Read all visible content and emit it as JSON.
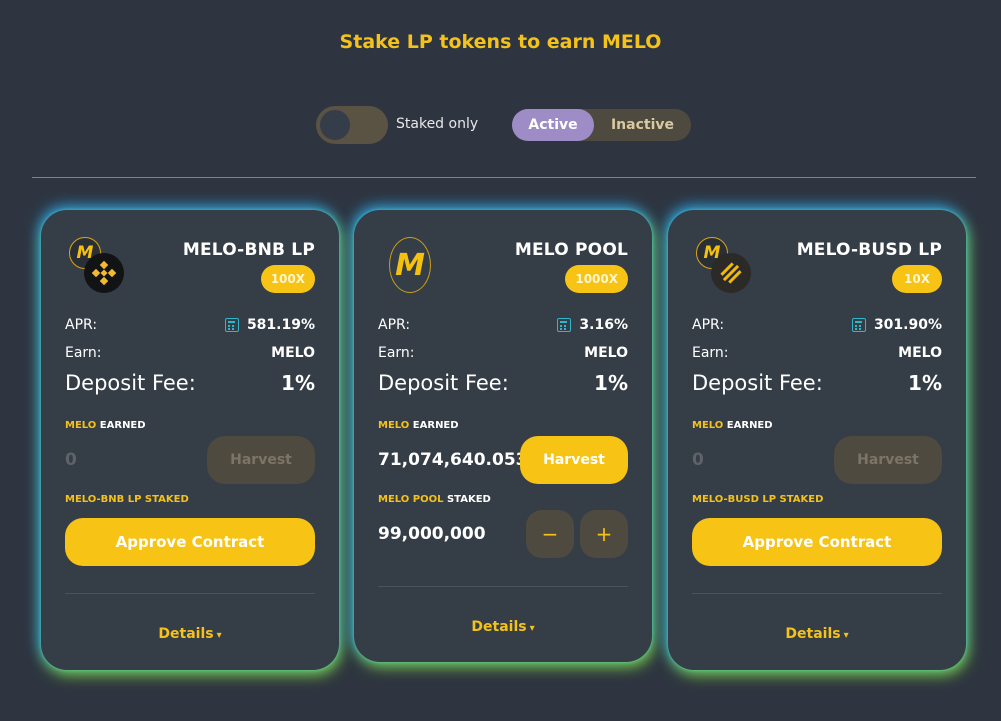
{
  "page": {
    "title": "Stake LP tokens to earn MELO"
  },
  "filters": {
    "staked_only_label": "Staked only",
    "staked_only_on": false,
    "tabs": [
      "Active",
      "Inactive"
    ],
    "active_tab": "Active"
  },
  "colors": {
    "accent": "#f7c415",
    "background": "#2e3540",
    "card": "#353d47",
    "active_tab": "#9d8cc6",
    "calculator_icon": "#2fb6c8"
  },
  "farms": [
    {
      "name": "MELO-BNB LP",
      "multiplier": "100X",
      "apr_label": "APR:",
      "apr": "581.19%",
      "earn_label": "Earn:",
      "earn": "MELO",
      "deposit_fee_label": "Deposit Fee:",
      "deposit_fee": "1%",
      "earned_token": "MELO",
      "earned_word": "EARNED",
      "earned": "0",
      "harvest_label": "Harvest",
      "staked_label": "MELO-BNB LP STAKED",
      "action_label": "Approve Contract",
      "details_label": "Details",
      "icons": [
        "melo-token-icon",
        "bnb-token-icon"
      ]
    },
    {
      "name": "MELO POOL",
      "multiplier": "1000X",
      "apr_label": "APR:",
      "apr": "3.16%",
      "earn_label": "Earn:",
      "earn": "MELO",
      "deposit_fee_label": "Deposit Fee:",
      "deposit_fee": "1%",
      "earned_token": "MELO",
      "earned_word": "EARNED",
      "earned": "71,074,640.053",
      "harvest_label": "Harvest",
      "staked_label_token": "MELO POOL",
      "staked_label_word": "STAKED",
      "staked": "99,000,000",
      "minus_label": "−",
      "plus_label": "+",
      "details_label": "Details",
      "icons": [
        "melo-token-icon"
      ]
    },
    {
      "name": "MELO-BUSD LP",
      "multiplier": "10X",
      "apr_label": "APR:",
      "apr": "301.90%",
      "earn_label": "Earn:",
      "earn": "MELO",
      "deposit_fee_label": "Deposit Fee:",
      "deposit_fee": "1%",
      "earned_token": "MELO",
      "earned_word": "EARNED",
      "earned": "0",
      "harvest_label": "Harvest",
      "staked_label": "MELO-BUSD LP STAKED",
      "action_label": "Approve Contract",
      "details_label": "Details",
      "icons": [
        "melo-token-icon",
        "busd-token-icon"
      ]
    }
  ]
}
